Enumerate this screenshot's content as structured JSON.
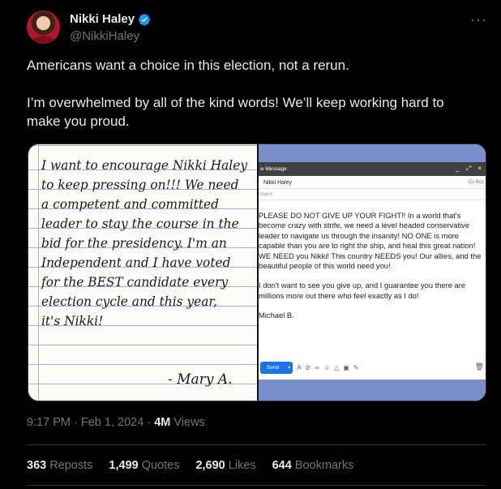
{
  "author": {
    "display_name": "Nikki Haley",
    "handle": "@NikkiHaley",
    "verified": true
  },
  "menu_icon": "more-horizontal-icon",
  "tweet": {
    "line1": "Americans want a choice in this election, not a rerun.",
    "line2": "I’m overwhelmed by all of the kind words! We’ll keep working hard to make you proud."
  },
  "media": {
    "handwritten_note": {
      "lines": [
        "I want to encourage Nikki Haley",
        "to keep pressing on!!! We need",
        "a competent and committed",
        "leader to stay the course in the",
        "bid for the presidency. I'm an",
        "Independent and I have voted",
        "for the BEST candidate every",
        "election cycle and this year,",
        "it's Nikki!"
      ],
      "signature": "- Mary A."
    },
    "email": {
      "window_title": "w Message",
      "to": "Nikki Haley",
      "cc_bcc": "Cc Bcc",
      "subject_placeholder": "ubject",
      "paragraph1": "PLEASE DO NOT GIVE UP YOUR FIGHT!! In a world that's become crazy with strife, we need a level headed conservative leader to navigate us through the insanity! NO ONE is more capable than you are to right the ship, and heal this great nation! WE NEED you Nikki! This country NEEDS you! Our allies, and the beautiful people of this world need you!",
      "paragraph2": "I don't want to see you give up, and I guarantee you there are millions more out there who feel exactly as I do!",
      "signoff": "Michael B.",
      "send_label": "Send"
    }
  },
  "meta": {
    "time": "9:17 PM",
    "date": "Feb 1, 2024",
    "views_count": "4M",
    "views_label": "Views"
  },
  "stats": {
    "reposts_count": "363",
    "reposts_label": "Reposts",
    "quotes_count": "1,499",
    "quotes_label": "Quotes",
    "likes_count": "2,690",
    "likes_label": "Likes",
    "bookmarks_count": "644",
    "bookmarks_label": "Bookmarks"
  },
  "colors": {
    "background": "#000000",
    "text": "#e7e9ea",
    "muted": "#71767b",
    "verified_blue": "#1d9bf0",
    "divider": "#2f3336"
  }
}
